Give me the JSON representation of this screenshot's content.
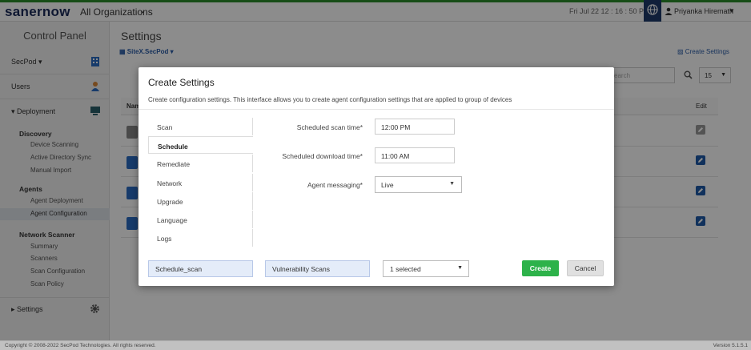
{
  "topbar": {
    "logo_saner": "saner",
    "logo_now": "now",
    "org_label": "All Organizations",
    "datetime": "Fri Jul 22   12 : 16 : 50 PM",
    "user_name": "Priyanka Hiremath"
  },
  "sidebar": {
    "title": "Control Panel",
    "secpod_label": "SecPod",
    "users_label": "Users",
    "deployment_label": "Deployment",
    "discovery_head": "Discovery",
    "discovery_items": [
      "Device Scanning",
      "Active Directory Sync",
      "Manual Import"
    ],
    "agents_head": "Agents",
    "agents_items": [
      "Agent Deployment",
      "Agent Configuration"
    ],
    "network_head": "Network Scanner",
    "network_items": [
      "Summary",
      "Scanners",
      "Scan Configuration",
      "Scan Policy"
    ],
    "settings_label": "Settings"
  },
  "main": {
    "title": "Settings",
    "site_selector": "SiteX.SecPod",
    "create_link": "Create Settings",
    "search_placeholder": "earch",
    "page_size": "15",
    "col_name": "Nam",
    "col_edit": "Edit"
  },
  "modal": {
    "title": "Create Settings",
    "description": "Create configuration settings. This interface allows you to create agent configuration settings that are applied to group of devices",
    "tabs": [
      "Scan",
      "Schedule",
      "Remediate",
      "Network",
      "Upgrade",
      "Language",
      "Logs"
    ],
    "active_tab": "Schedule",
    "fields": {
      "scan_time_label": "Scheduled scan time*",
      "scan_time_value": "12:00 PM",
      "download_time_label": "Scheduled download time*",
      "download_time_value": "11:00 AM",
      "messaging_label": "Agent messaging*",
      "messaging_value": "Live"
    },
    "name_value": "Schedule_scan",
    "category_value": "Vulnerability Scans",
    "group_value": "1 selected",
    "create_label": "Create",
    "cancel_label": "Cancel"
  },
  "footer": {
    "copyright": "Copyright © 2008-2022 SecPod Technologies. All rights reserved.",
    "version": "Version 5.1.5.1"
  },
  "colors": {
    "accent_green": "#2db24a",
    "brand_navy": "#1a2a5a",
    "link_blue": "#2b5da8"
  }
}
